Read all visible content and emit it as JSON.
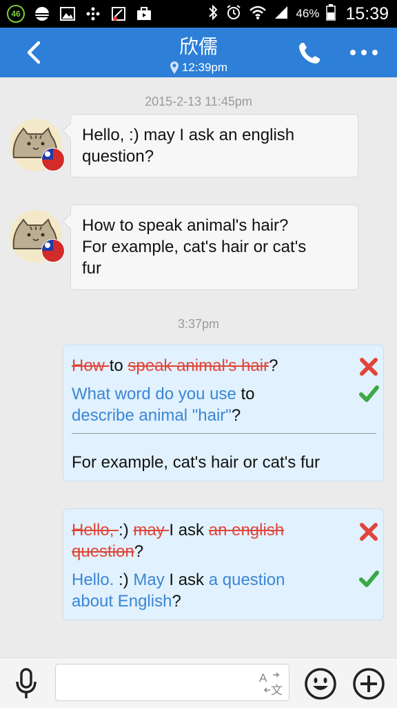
{
  "status_bar": {
    "badge": "46",
    "battery_percent": "46%",
    "time": "15:39"
  },
  "header": {
    "title": "欣儒",
    "subtitle_time": "12:39pm"
  },
  "chat": {
    "timestamp_1": "2015-2-13 11:45pm",
    "msg_1_line_1": "Hello, :) may I ask an english",
    "msg_1_line_2": "question?",
    "msg_2_line_1": "How to speak animal's hair?",
    "msg_2_line_2": "For example, cat's hair or cat's",
    "msg_2_line_3": "fur",
    "timestamp_2": "3:37pm",
    "corr_1": {
      "wrong_how": "How ",
      "to": "to ",
      "wrong_speak": "speak animal's hair",
      "q": "?",
      "right_l1_a": "What word do you use",
      "right_l1_b": " to",
      "right_l2_a": "describe animal \"hair\"",
      "right_l2_b": "?",
      "extra": "For example, cat's hair or cat's fur"
    },
    "corr_2": {
      "wrong_hello": "Hello, ",
      "smile": ":) ",
      "wrong_may": "may ",
      "i_ask": "I ask ",
      "wrong_english": "an english",
      "wrong_question": "question",
      "q": "?",
      "right_hello": "Hello.",
      "smile2": " :) ",
      "right_may": "May",
      "i_ask2": " I ask ",
      "right_a_question": "a question",
      "right_about": "about English",
      "q2": "?"
    }
  },
  "input": {
    "value": "",
    "placeholder": ""
  },
  "icons": {
    "back": "back-arrow-icon",
    "location": "location-pin-icon",
    "phone": "phone-icon",
    "more": "more-dots-icon",
    "mic": "microphone-icon",
    "translate": "translate-icon",
    "emoji": "emoji-icon",
    "plus": "plus-icon"
  },
  "colors": {
    "header": "#2d7fd7",
    "wrong": "#e0453a",
    "correct": "#3a86d4",
    "check": "#3aa845"
  }
}
